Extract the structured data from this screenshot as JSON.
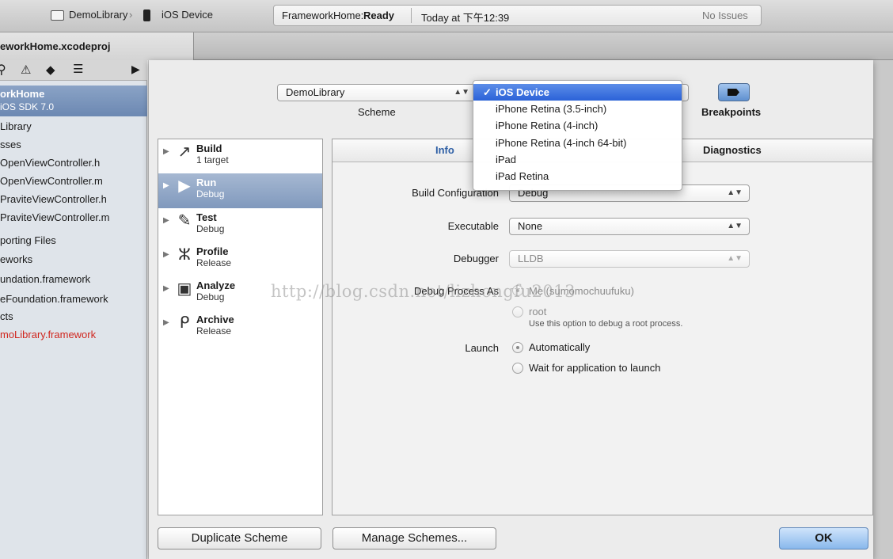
{
  "toolbar": {
    "breadcrumb_project": "DemoLibrary",
    "breadcrumb_device": "iOS Device",
    "status_app": "FrameworkHome:",
    "status_state": "Ready",
    "status_time": "Today at 下午12:39",
    "status_issues": "No Issues"
  },
  "tab": {
    "title": "eworkHome.xcodeproj"
  },
  "navigator": {
    "selected_title": "orkHome",
    "selected_subtitle": "iOS SDK 7.0",
    "items": [
      "Library",
      "sses",
      "OpenViewController.h",
      "OpenViewController.m",
      "PraviteViewController.h",
      "PraviteViewController.m",
      "porting Files",
      "eworks",
      "undation.framework",
      "eFoundation.framework",
      "cts",
      "moLibrary.framework"
    ],
    "red_item_color": "#d0261e"
  },
  "scheme": {
    "popup_value": "DemoLibrary",
    "label": "Scheme",
    "breakpoints_label": "Breakpoints"
  },
  "device_menu": {
    "check": "✓",
    "items": [
      "iOS Device",
      "iPhone Retina (3.5-inch)",
      "iPhone Retina (4-inch)",
      "iPhone Retina (4-inch 64-bit)",
      "iPad",
      "iPad Retina"
    ],
    "selected_index": 0
  },
  "actions": [
    {
      "name": "Build",
      "sub": "1 target",
      "icon": "hammer-icon"
    },
    {
      "name": "Run",
      "sub": "Debug",
      "icon": "play-icon"
    },
    {
      "name": "Test",
      "sub": "Debug",
      "icon": "wrench-icon"
    },
    {
      "name": "Profile",
      "sub": "Release",
      "icon": "tuning-fork-icon"
    },
    {
      "name": "Analyze",
      "sub": "Debug",
      "icon": "analyze-icon"
    },
    {
      "name": "Archive",
      "sub": "Release",
      "icon": "archive-icon"
    }
  ],
  "detail": {
    "tabs": [
      "Info",
      "Diagnostics"
    ],
    "build_configuration_label": "Build Configuration",
    "build_configuration_value": "Debug",
    "executable_label": "Executable",
    "executable_value": "None",
    "debugger_label": "Debugger",
    "debugger_value": "LLDB",
    "debug_process_label": "Debug Process As",
    "debug_process_me": "Me (sumomochuufuku)",
    "debug_process_root": "root",
    "debug_process_root_hint": "Use this option to debug a root process.",
    "launch_label": "Launch",
    "launch_auto": "Automatically",
    "launch_wait": "Wait for application to launch"
  },
  "buttons": {
    "duplicate": "Duplicate Scheme",
    "manage": "Manage Schemes...",
    "ok": "OK"
  },
  "watermark": "http://blog.csdn.net/lizhongfu2013",
  "colors": {
    "selection_blue": "#2b62d8",
    "ok_button": "#89b8ec"
  }
}
